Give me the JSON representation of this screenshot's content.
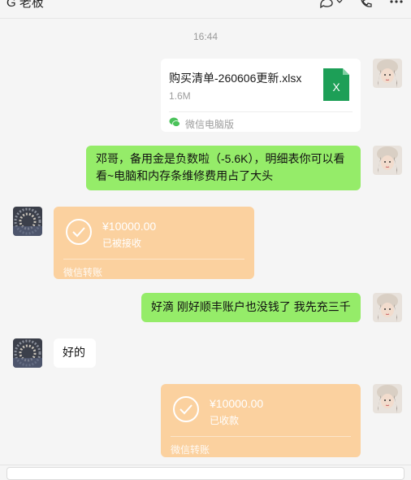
{
  "header": {
    "title": "G 老板"
  },
  "timestamp": "16:44",
  "file_message": {
    "name": "购买清单-260606更新.xlsx",
    "size": "1.6M",
    "source": "微信电脑版",
    "icon": "excel-file-icon",
    "icon_letter": "X"
  },
  "messages": {
    "msg1_line1": "邓哥，备用金是负数啦（-5.6K），明细表你可以看",
    "msg1_line2": "看~电脑和内存条维修费用占了大头",
    "msg2": "好滴 刚好顺丰账户也没钱了 我先充三千",
    "msg3": "好的"
  },
  "transfer_received": {
    "amount": "¥10000.00",
    "status": "已被接收",
    "label": "微信转账"
  },
  "transfer_sent": {
    "amount": "¥10000.00",
    "status": "已收款",
    "label": "微信转账"
  },
  "colors": {
    "green_bubble": "#95ec69",
    "transfer_orange": "#fbd19f",
    "excel_green": "#1d9f57"
  }
}
